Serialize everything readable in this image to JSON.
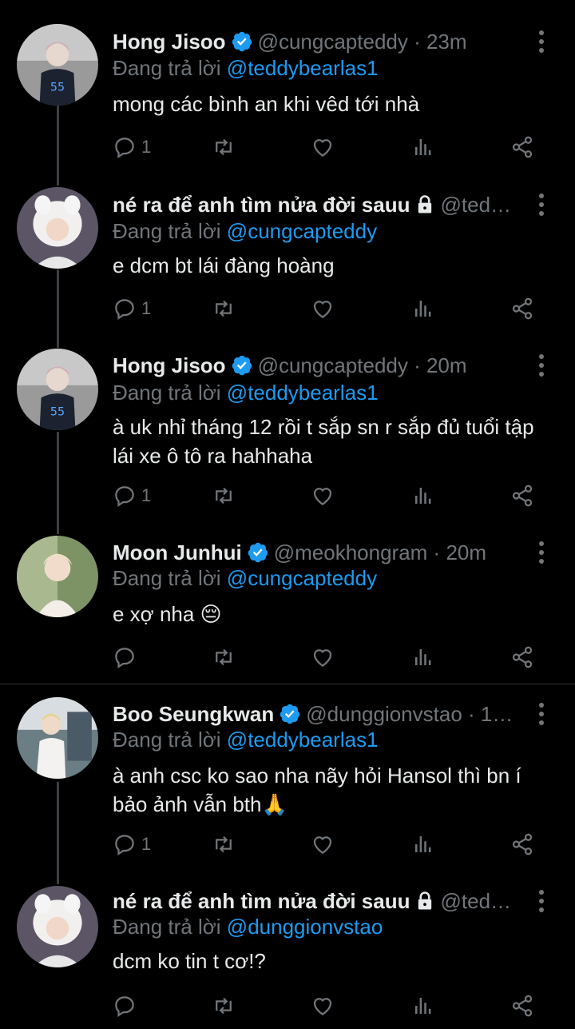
{
  "tweets": [
    {
      "name": "Hong Jisoo",
      "verified": true,
      "handle_time": "@cungcapteddy · 23m",
      "reply_prefix": "Đang trả lời",
      "reply_to": "@teddybearlas1",
      "text": "mong các bình an khi vêd tới nhà",
      "reply_count": "1"
    },
    {
      "name": "né ra để anh tìm nửa đời sauu",
      "locked": true,
      "handle_time": "@ted…",
      "reply_prefix": "Đang trả lời",
      "reply_to": "@cungcapteddy",
      "text": "e dcm bt lái đàng hoàng",
      "reply_count": "1"
    },
    {
      "name": "Hong Jisoo",
      "verified": true,
      "handle_time": "@cungcapteddy · 20m",
      "reply_prefix": "Đang trả lời",
      "reply_to": "@teddybearlas1",
      "text": "à uk nhỉ tháng 12 rồi t sắp sn r sắp đủ tuổi tập lái xe ô tô ra hahhaha",
      "reply_count": "1"
    },
    {
      "name": "Moon Junhui",
      "verified": true,
      "handle_time": "@meokhongram · 20m",
      "reply_prefix": "Đang trả lời",
      "reply_to": "@cungcapteddy",
      "text": "e xợ nha 😔",
      "reply_count": ""
    },
    {
      "name": "Boo Seungkwan",
      "verified": true,
      "handle_time": "@dunggionvstao · 1…",
      "reply_prefix": "Đang trả lời",
      "reply_to": "@teddybearlas1",
      "text": "à anh csc ko sao nha nãy hỏi Hansol thì bn í bảo ảnh vẫn bth🙏",
      "reply_count": "1"
    },
    {
      "name": "né ra để anh tìm nửa đời sauu",
      "locked": true,
      "handle_time": "@ted…",
      "reply_prefix": "Đang trả lời",
      "reply_to": "@dunggionvstao",
      "text": "dcm ko tin t cơ!?",
      "reply_count": ""
    }
  ],
  "icons": {
    "reply": "reply-icon",
    "retweet": "retweet-icon",
    "like": "heart-icon",
    "views": "analytics-icon",
    "share": "share-icon",
    "more": "more-dots-icon",
    "verified": "verified-badge-icon",
    "lock": "lock-icon"
  },
  "colors": {
    "background": "#000000",
    "text": "#e7e9ea",
    "muted": "#71767b",
    "accent": "#1d9bf0"
  }
}
